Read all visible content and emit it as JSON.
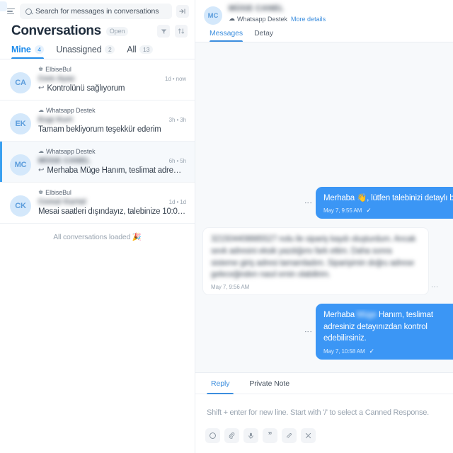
{
  "sidebar": {
    "search": {
      "placeholder": "Search for messages in conversations",
      "icon": "search-icon"
    },
    "menu_icon": "hamburger-icon",
    "collapse_icon": "collapse-panel-icon",
    "title": "Conversations",
    "status_pill": "Open",
    "filter_icon": "filter-funnel-icon",
    "sort_icon": "sort-icon",
    "tabs": [
      {
        "label": "Mine",
        "count": "4",
        "active": true
      },
      {
        "label": "Unassigned",
        "count": "2",
        "active": false
      },
      {
        "label": "All",
        "count": "13",
        "active": false
      }
    ],
    "conversations": [
      {
        "initials": "CA",
        "channel": "ElbiseBul",
        "channel_icon": "globe-icon",
        "customer_name": "Cem Ayaz",
        "time": "1d • now",
        "preview": "Kontrolünü sağlıyorum",
        "has_reply_arrow": true,
        "selected": false
      },
      {
        "initials": "EK",
        "channel": "Whatsapp Destek",
        "channel_icon": "cloud-icon",
        "customer_name": "Ezgi Kurt",
        "time": "3h • 3h",
        "preview": "Tamam bekliyorum teşekkür ederim",
        "has_reply_arrow": false,
        "selected": false
      },
      {
        "initials": "MC",
        "channel": "Whatsapp Destek",
        "channel_icon": "cloud-icon",
        "customer_name": "MÜGE CANEL",
        "time": "6h • 5h",
        "preview": "Merhaba Müge Hanım, teslimat adre…",
        "has_reply_arrow": true,
        "selected": true
      },
      {
        "initials": "CK",
        "channel": "ElbiseBul",
        "channel_icon": "globe-icon",
        "customer_name": "Cemal Kartal",
        "time": "1d • 1d",
        "preview": "Mesai saatleri dışındayız, talebinize 10:0…",
        "has_reply_arrow": false,
        "selected": false
      }
    ],
    "list_end_note": "All conversations loaded 🎉"
  },
  "chat": {
    "header": {
      "initials": "MC",
      "contact_name": "MÜGE CANEL",
      "channel": "Whatsapp Destek",
      "channel_icon": "cloud-icon",
      "more_details": "More details",
      "tabs": [
        {
          "label": "Messages",
          "active": true
        },
        {
          "label": "Detay",
          "active": false
        }
      ]
    },
    "messages": [
      {
        "direction": "out",
        "text": "Merhaba 👋, lütfen talebinizi detaylı bir şekilde yazınız, arkadaşlarımız mümkün olan en kısa sü",
        "time": "May 7, 9:55 AM",
        "status_icon": "check-icon",
        "redacted": false,
        "menu_icon": "more-vertical-icon"
      },
      {
        "direction": "in",
        "text": "321504408885527 nolu ile sipariş kaydı oluşturdum. Ancak sevk adresini eksik yazdığımı fark ettim. Daha sonra sisteme giriş adresi tamamladım. Siparişimin doğru adrese geleceğinden nasıl emin olabilirim.",
        "time": "May 7, 9:56 AM",
        "status_icon": "",
        "redacted": true,
        "menu_icon": "more-vertical-icon"
      },
      {
        "direction": "out",
        "text_before": "Merhaba ",
        "redacted_name": "Müge",
        "text_after": " Hanım, teslimat adresiniz detayınızdan kontrol edebilirsiniz.",
        "time": "May 7, 10:58 AM",
        "status_icon": "check-icon",
        "redacted": false,
        "menu_icon": "more-vertical-icon"
      }
    ],
    "composer": {
      "tabs": [
        {
          "label": "Reply",
          "active": true
        },
        {
          "label": "Private Note",
          "active": false
        }
      ],
      "placeholder": "Shift + enter for new line. Start with '/' to select a Canned Response.",
      "toolbar": [
        {
          "icon": "emoji-icon",
          "glyph": "☺"
        },
        {
          "icon": "attachment-paperclip-icon",
          "glyph": "🖇"
        },
        {
          "icon": "microphone-icon",
          "glyph": "🎙"
        },
        {
          "icon": "quote-icon",
          "glyph": "”"
        },
        {
          "icon": "signature-icon",
          "glyph": "✎"
        },
        {
          "icon": "shortcut-icon",
          "glyph": "✂"
        }
      ]
    }
  },
  "colors": {
    "accent": "#1f8ceb",
    "bubble_out": "#3b96f5",
    "avatar_bg": "#d4e8fb",
    "msg_area_bg": "#f7f9fb",
    "selected_row": "#f6f9fc"
  }
}
